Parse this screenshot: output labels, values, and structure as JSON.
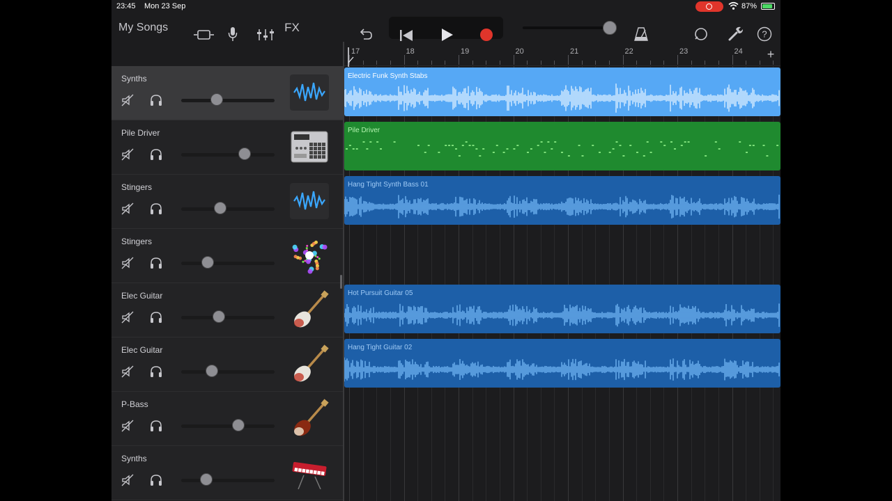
{
  "status_bar": {
    "time": "23:45",
    "date": "Mon 23 Sep",
    "battery": "87%"
  },
  "toolbar": {
    "my_songs": "My Songs",
    "fx": "FX"
  },
  "ruler": {
    "bars": [
      "17",
      "18",
      "19",
      "20",
      "21",
      "22",
      "23",
      "24"
    ]
  },
  "tracks": [
    {
      "name": "Synths",
      "instrument": "waveform-icon",
      "volume": 0.38,
      "selected": true
    },
    {
      "name": "Pile Driver",
      "instrument": "drum-machine-icon",
      "volume": 0.68
    },
    {
      "name": "Stingers",
      "instrument": "waveform-icon",
      "volume": 0.42
    },
    {
      "name": "Stingers",
      "instrument": "sparkle-icon",
      "volume": 0.28
    },
    {
      "name": "Elec Guitar",
      "instrument": "guitar-icon",
      "volume": 0.4
    },
    {
      "name": "Elec Guitar",
      "instrument": "guitar-icon",
      "volume": 0.33
    },
    {
      "name": "P-Bass",
      "instrument": "bass-guitar-icon",
      "volume": 0.61
    },
    {
      "name": "Synths",
      "instrument": "keyboard-icon",
      "volume": 0.27
    }
  ],
  "regions": [
    {
      "name": "Electric Funk Synth Stabs",
      "style": "audio-sel"
    },
    {
      "name": "Pile Driver",
      "style": "green"
    },
    {
      "name": "Hang Tight Synth Bass 01",
      "style": "blue"
    },
    null,
    {
      "name": "Hot Pursuit Guitar 05",
      "style": "blue"
    },
    {
      "name": "Hang Tight Guitar 02",
      "style": "blue"
    }
  ],
  "colors": {
    "record": "#e0352b",
    "selected_region": "#56a8f5",
    "drummer_region": "#1f8a2f",
    "audio_region": "#1d5fa8"
  }
}
